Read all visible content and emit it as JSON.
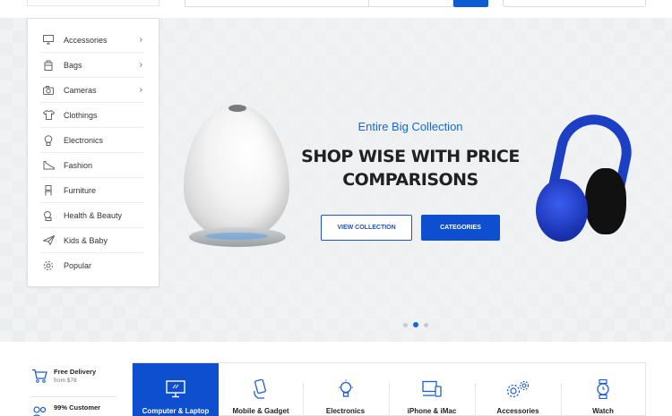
{
  "header": {},
  "categories": {
    "items": [
      {
        "label": "Accessories",
        "icon": "monitor-icon",
        "has_submenu": true
      },
      {
        "label": "Bags",
        "icon": "bag-icon",
        "has_submenu": true
      },
      {
        "label": "Cameras",
        "icon": "camera-icon",
        "has_submenu": true
      },
      {
        "label": "Clothings",
        "icon": "shirt-icon",
        "has_submenu": false
      },
      {
        "label": "Electronics",
        "icon": "bulb-icon",
        "has_submenu": false
      },
      {
        "label": "Fashion",
        "icon": "shoe-icon",
        "has_submenu": false
      },
      {
        "label": "Furniture",
        "icon": "chair-icon",
        "has_submenu": false
      },
      {
        "label": "Health & Beauty",
        "icon": "bottle-icon",
        "has_submenu": false
      },
      {
        "label": "Kids & Baby",
        "icon": "plane-icon",
        "has_submenu": false
      },
      {
        "label": "Popular",
        "icon": "gear-icon",
        "has_submenu": false
      }
    ],
    "submenu_arrow": "›"
  },
  "hero": {
    "subtitle": "Entire Big Collection",
    "title_line1": "SHOP WISE WITH PRICE",
    "title_line2": "COMPARISONS",
    "view_collection_label": "VIEW COLLECTION",
    "categories_label": "CATEGORIES",
    "slide_count": 3,
    "active_slide": 2
  },
  "features": [
    {
      "title": "Free Delivery",
      "subtitle": "from $78",
      "icon": "cart-icon"
    },
    {
      "title": "99% Customer",
      "subtitle": "",
      "icon": "people-icon"
    }
  ],
  "category_strip": [
    {
      "label": "Computer & Laptop",
      "icon": "monitor-icon",
      "active": true
    },
    {
      "label": "Mobile & Gadget",
      "icon": "hand-phone-icon",
      "active": false
    },
    {
      "label": "Electronics",
      "icon": "bulb-icon",
      "active": false
    },
    {
      "label": "iPhone & iMac",
      "icon": "devices-icon",
      "active": false
    },
    {
      "label": "Accessories",
      "icon": "gears-icon",
      "active": false
    },
    {
      "label": "Watch",
      "icon": "watch-icon",
      "active": false
    }
  ],
  "colors": {
    "accent": "#0e4fd0",
    "link": "#1668d6",
    "hero_bg": "#eef0f1"
  }
}
